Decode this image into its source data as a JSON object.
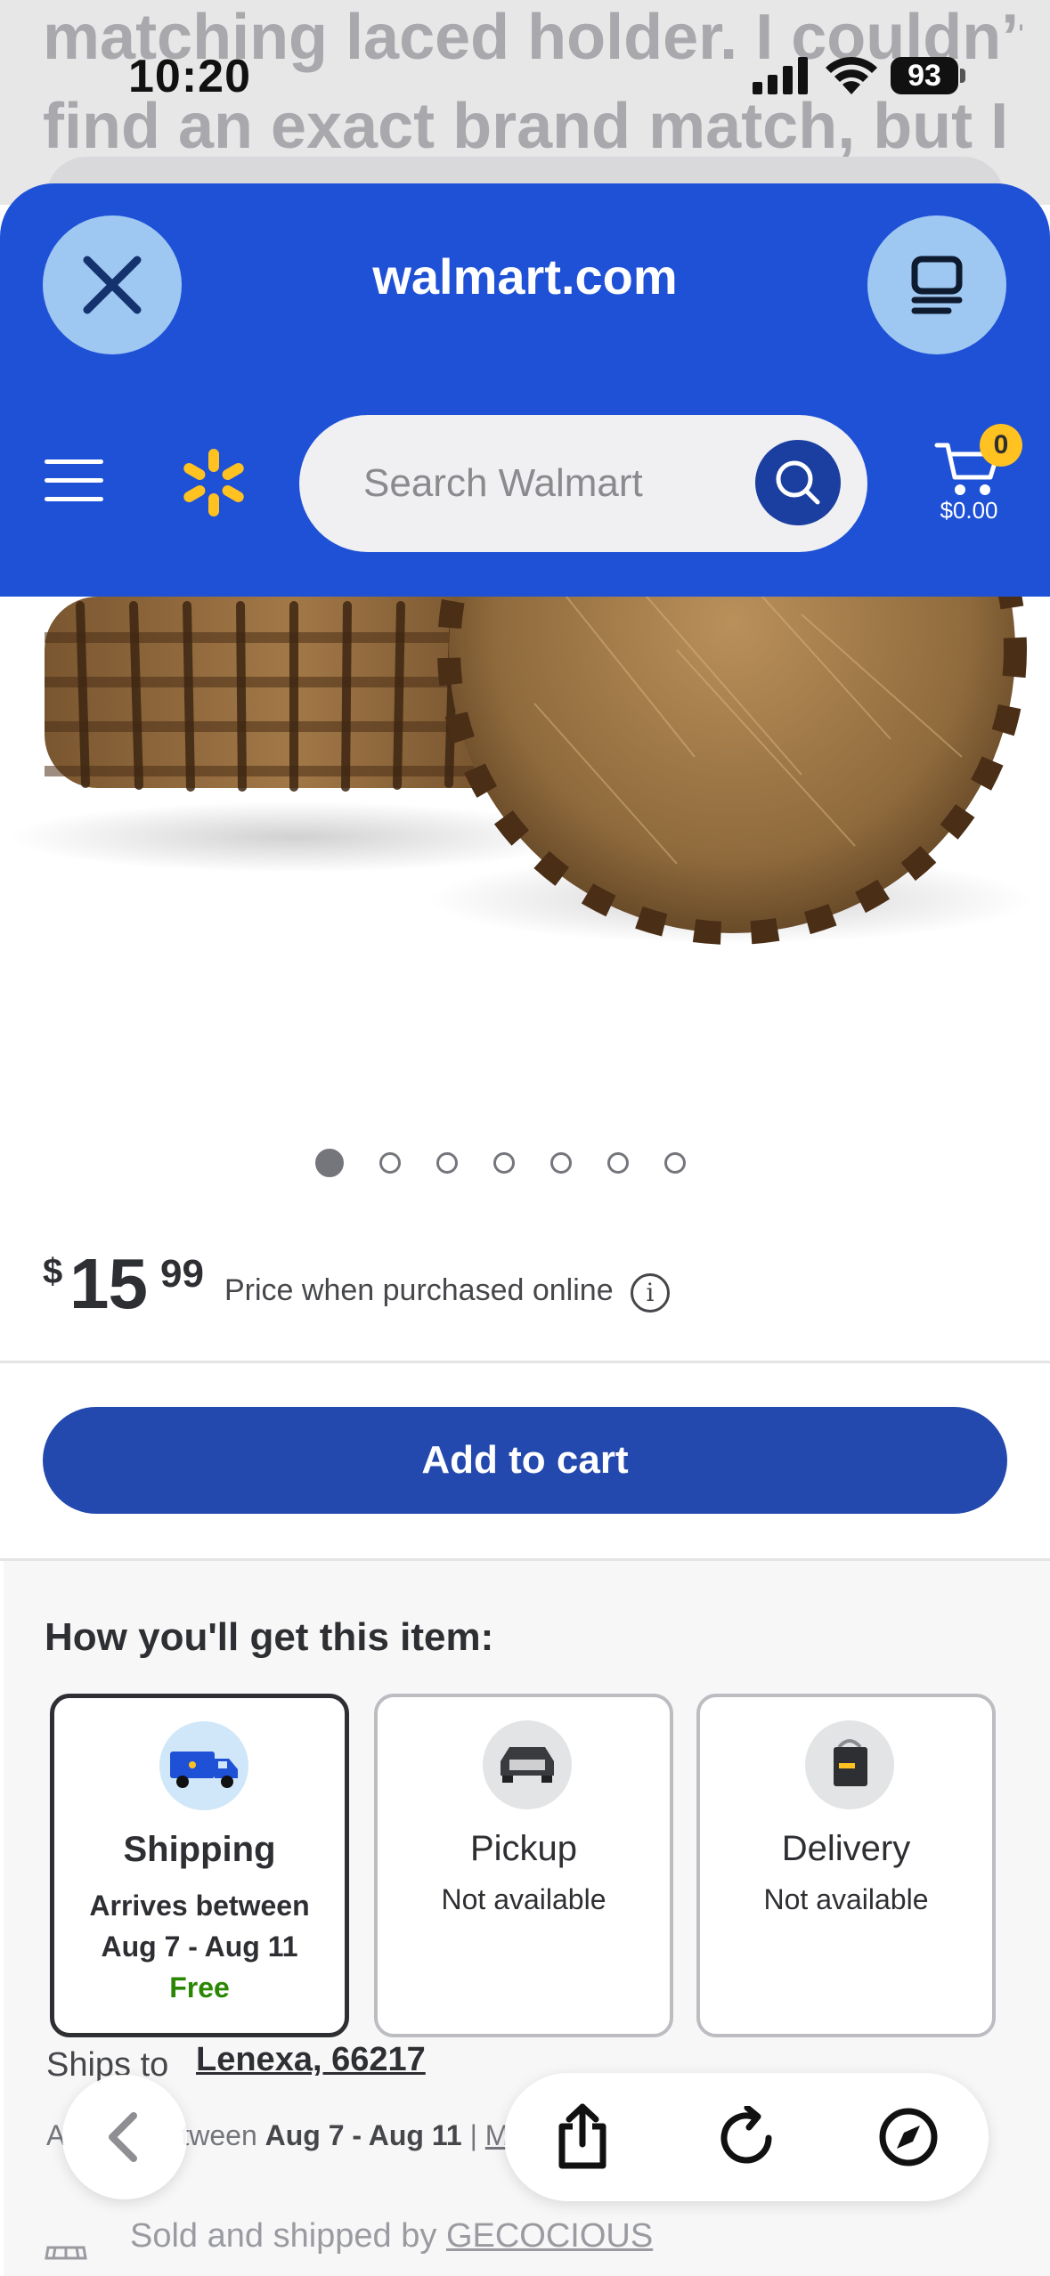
{
  "background_message": {
    "line1": "matching laced holder. I couldn’t",
    "line2": "find an exact brand match, but I"
  },
  "status_bar": {
    "time": "10:20",
    "battery": "93"
  },
  "browser_sheet": {
    "domain": "walmart.com",
    "close_icon": "close-icon",
    "tabs_icon": "tab-overview-icon"
  },
  "header": {
    "menu_icon": "hamburger-menu-icon",
    "logo_icon": "walmart-spark-icon",
    "search_placeholder": "Search Walmart",
    "cart_count": "0",
    "cart_total": "$0.00",
    "accent_color": "#1f51d6",
    "spark_color": "#ffc220"
  },
  "carousel": {
    "total_images": 7,
    "active_index": 0
  },
  "product": {
    "currency": "$",
    "price_dollars": "15",
    "price_cents": "99",
    "price_note": "Price when purchased online",
    "add_to_cart": "Add to cart",
    "button_color": "#2449ae"
  },
  "fulfillment": {
    "heading": "How you'll get this item:",
    "options": [
      {
        "title": "Shipping",
        "line1": "Arrives between",
        "line2": "Aug 7 - Aug 11",
        "line3": "Free",
        "selected": true,
        "icon": "shipping-truck-icon"
      },
      {
        "title": "Pickup",
        "line1": "Not available",
        "selected": false,
        "icon": "pickup-car-icon"
      },
      {
        "title": "Delivery",
        "line1": "Not available",
        "selected": false,
        "icon": "delivery-bag-icon"
      }
    ],
    "ships_to_label": "Ships to",
    "ships_to_location": "Lenexa, 66217",
    "arrives_prefix": "A",
    "arrives_mid": "tween",
    "arrives_dates": "Aug 7 - Aug 11",
    "arrives_divider": "|",
    "arrives_tail": "M",
    "sold_by_label": "Sold and shipped by",
    "seller": "GECOCIOUS"
  },
  "safari_toolbar": {
    "back_icon": "chevron-left-icon",
    "share_icon": "share-icon",
    "reload_icon": "reload-icon",
    "compass_icon": "compass-icon"
  }
}
